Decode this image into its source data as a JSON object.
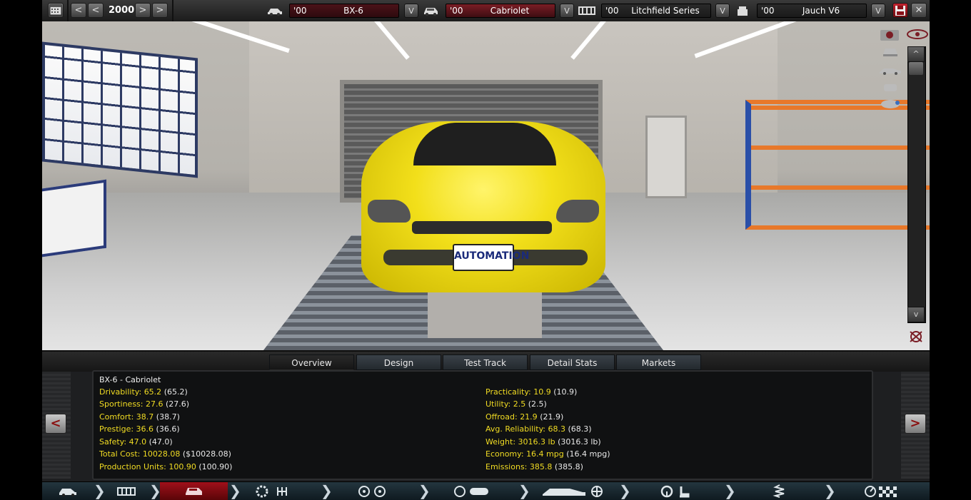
{
  "topbar": {
    "year": "2000",
    "model_year": "'00",
    "model_name": "BX-6",
    "trim_year": "'00",
    "trim_name": "Cabriolet",
    "family_year": "'00",
    "family_name": "Litchfield Series",
    "engine_year": "'00",
    "engine_name": "Jauch V6",
    "prev_big": "<",
    "prev_small": "<",
    "next_small": ">",
    "next_big": ">",
    "drop": "V",
    "save_icon": "save-icon",
    "close_label": "✕"
  },
  "viewport": {
    "plate_text": "AUTOMATION",
    "scroll_up": "^",
    "scroll_down": "v",
    "icons": [
      "camera-icon",
      "eye-icon",
      "car-front-icon",
      "car-side-icon",
      "car-rear-icon",
      "car-top-icon",
      "reset-view-icon"
    ]
  },
  "tabs": [
    {
      "label": "Overview",
      "active": true
    },
    {
      "label": "Design",
      "active": false
    },
    {
      "label": "Test Track",
      "active": false
    },
    {
      "label": "Detail Stats",
      "active": false
    },
    {
      "label": "Markets",
      "active": false
    }
  ],
  "overview": {
    "title": "BX-6 - Cabriolet",
    "left": [
      {
        "label": "Drivability:",
        "value": "65.2",
        "paren": "(65.2)"
      },
      {
        "label": "Sportiness:",
        "value": "27.6",
        "paren": "(27.6)"
      },
      {
        "label": "Comfort:",
        "value": "38.7",
        "paren": "(38.7)"
      },
      {
        "label": "Prestige:",
        "value": "36.6",
        "paren": "(36.6)"
      },
      {
        "label": "Safety:",
        "value": "47.0",
        "paren": "(47.0)"
      },
      {
        "label": "Total Cost:",
        "value": "10028.08",
        "paren": "($10028.08)"
      },
      {
        "label": "Production Units:",
        "value": "100.90",
        "paren": "(100.90)"
      }
    ],
    "right": [
      {
        "label": "Practicality:",
        "value": "10.9",
        "paren": "(10.9)"
      },
      {
        "label": "Utility:",
        "value": "2.5",
        "paren": "(2.5)"
      },
      {
        "label": "Offroad:",
        "value": "21.9",
        "paren": "(21.9)"
      },
      {
        "label": "Avg. Reliability:",
        "value": "68.3",
        "paren": "(68.3)"
      },
      {
        "label": "Weight:",
        "value": "3016.3 lb",
        "paren": "(3016.3 lb)"
      },
      {
        "label": "Economy:",
        "value": "16.4 mpg",
        "paren": "(16.4 mpg)"
      },
      {
        "label": "Emissions:",
        "value": "385.8",
        "paren": "(385.8)"
      }
    ],
    "prev": "<",
    "next": ">"
  },
  "nav": {
    "items": [
      {
        "icon": "car-model-icon",
        "active": false
      },
      {
        "icon": "chassis-icon",
        "active": false
      },
      {
        "icon": "trim-icon",
        "active": true
      },
      {
        "icon": "engine-gearbox-icon",
        "active": false
      },
      {
        "icon": "wheels-icon",
        "active": false
      },
      {
        "icon": "brakes-icon",
        "active": false
      },
      {
        "icon": "aero-cooling-icon",
        "active": false
      },
      {
        "icon": "interior-icon",
        "active": false
      },
      {
        "icon": "suspension-icon",
        "active": false
      },
      {
        "icon": "test-finish-icon",
        "active": false
      }
    ]
  },
  "colors": {
    "accent_red": "#8a1018",
    "stat_yellow": "#f1dc23",
    "car_yellow": "#f2df1a",
    "shelf_orange": "#e8782a",
    "shelf_blue": "#2a4fa8"
  }
}
